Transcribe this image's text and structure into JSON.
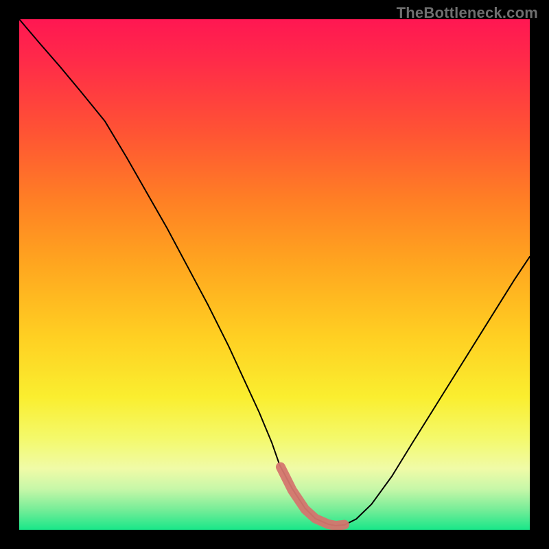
{
  "watermark": "TheBottleneck.com",
  "chart_data": {
    "type": "line",
    "title": "",
    "xlabel": "",
    "ylabel": "",
    "xlim": [
      0,
      100
    ],
    "ylim": [
      0,
      100
    ],
    "series": [
      {
        "name": "curve",
        "x": [
          0,
          4,
          8,
          12,
          16.8,
          21,
          25,
          29,
          33,
          37,
          41,
          44,
          47,
          49.5,
          51,
          53.5,
          56,
          58,
          60.5,
          62,
          63.7,
          66,
          69,
          73,
          77,
          82,
          87,
          92,
          97,
          100
        ],
        "y": [
          100,
          95.3,
          90.7,
          85.9,
          80,
          73,
          66,
          59,
          51.5,
          44,
          36,
          29.5,
          23,
          17,
          12.7,
          8,
          4.2,
          2.2,
          1.1,
          0.8,
          0.95,
          2.1,
          5,
          10.5,
          17,
          25,
          33,
          41,
          49,
          53.5
        ]
      }
    ],
    "highlight": {
      "name": "bottom-band",
      "color": "#d4756e",
      "x": [
        51.2,
        53.5,
        56,
        58,
        60.5,
        62,
        63.7
      ],
      "y": [
        12.3,
        7.7,
        4.0,
        2.2,
        1.1,
        0.8,
        1.0
      ]
    }
  }
}
